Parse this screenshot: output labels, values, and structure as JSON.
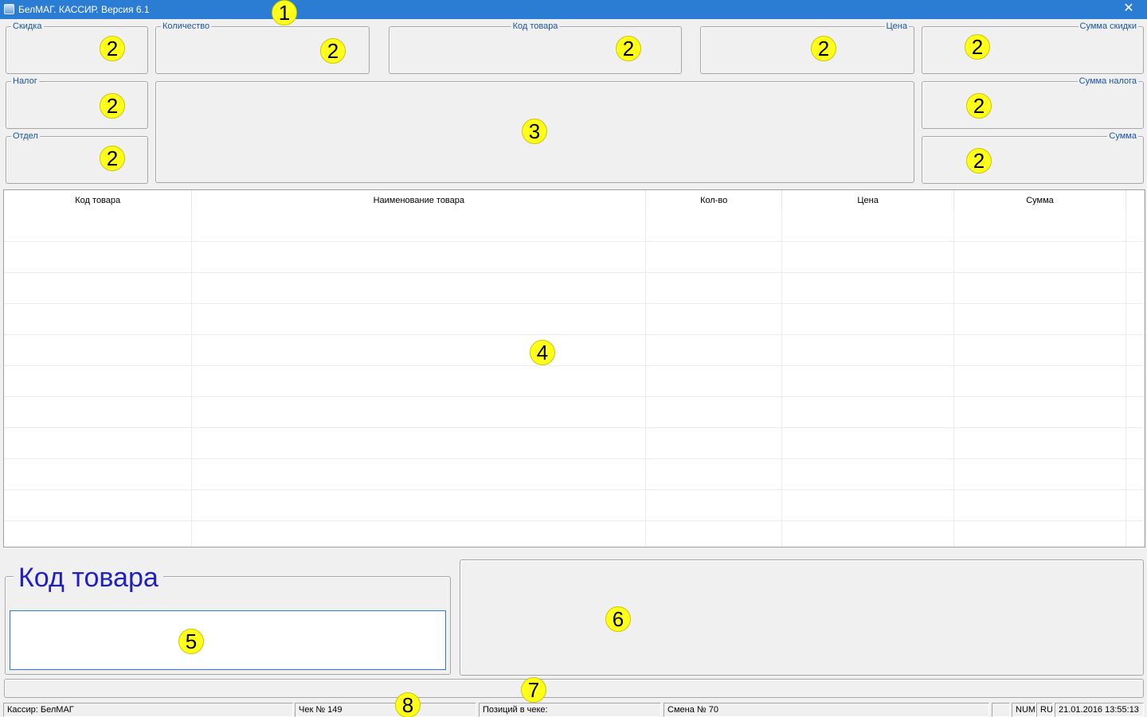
{
  "window": {
    "title": "БелМАГ. КАССИР. Версия 6.1",
    "close_label": "✕",
    "icon": "app-icon"
  },
  "fields": {
    "discount": "Скидка",
    "quantity": "Количество",
    "product_code": "Код товара",
    "price": "Цена",
    "discount_sum": "Сумма скидки",
    "tax": "Налог",
    "tax_sum": "Сумма налога",
    "department": "Отдел",
    "sum": "Сумма"
  },
  "grid": {
    "columns": [
      "Код товара",
      "Наименование товара",
      "Кол-во",
      "Цена",
      "Сумма"
    ],
    "rows": []
  },
  "code_entry": {
    "legend": "Код товара",
    "value": ""
  },
  "status_bar": {
    "cashier": "Кассир: БелМАГ",
    "receipt": "Чек № 149",
    "positions": "Позиций в чеке:",
    "shift": "Смена № 70",
    "empty": "",
    "num": "NUM",
    "lang": "RU",
    "datetime": "21.01.2016  13:55:13"
  },
  "callouts": {
    "c1": "1",
    "c2": "2",
    "c3": "3",
    "c4": "4",
    "c5": "5",
    "c6": "6",
    "c7": "7",
    "c8": "8"
  },
  "colors": {
    "titlebar": "#2b7cd3",
    "legend_text": "#1a55a0",
    "code_legend": "#1f1fc8",
    "callout": "#ffff1a"
  }
}
